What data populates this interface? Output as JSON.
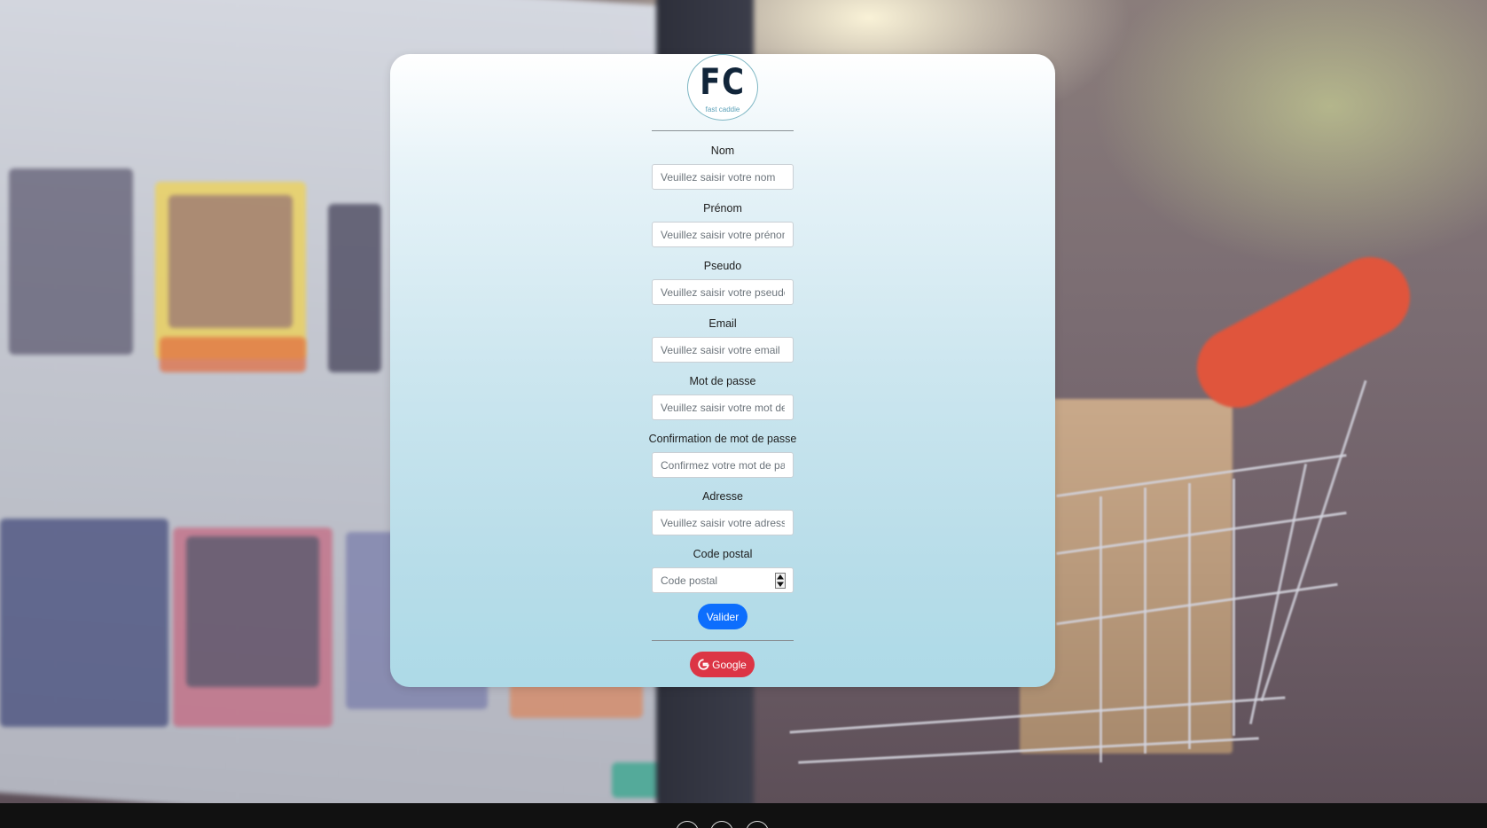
{
  "brand": {
    "logo_letters": "FC",
    "logo_subtitle": "fast caddie"
  },
  "form": {
    "fields": [
      {
        "label": "Nom",
        "placeholder": "Veuillez saisir votre nom",
        "type": "text"
      },
      {
        "label": "Prénom",
        "placeholder": "Veuillez saisir votre prénom",
        "type": "text"
      },
      {
        "label": "Pseudo",
        "placeholder": "Veuillez saisir votre pseudo",
        "type": "text"
      },
      {
        "label": "Email",
        "placeholder": "Veuillez saisir votre email",
        "type": "email"
      },
      {
        "label": "Mot de passe",
        "placeholder": "Veuillez saisir votre mot de passe",
        "type": "password"
      },
      {
        "label": "Confirmation de mot de passe",
        "placeholder": "Confirmez votre mot de passe",
        "type": "password"
      },
      {
        "label": "Adresse",
        "placeholder": "Veuillez saisir votre adresse",
        "type": "text"
      },
      {
        "label": "Code postal",
        "placeholder": "Code postal",
        "type": "number"
      }
    ],
    "submit_label": "Valider",
    "google_label": "Google"
  },
  "icons": {
    "google": "google-g-icon",
    "spinner": "number-spinner-icon"
  },
  "colors": {
    "primary": "#0d6efd",
    "danger": "#dc3545",
    "card_top": "#ffffff",
    "card_bottom": "#addae7",
    "footer": "#111111"
  }
}
